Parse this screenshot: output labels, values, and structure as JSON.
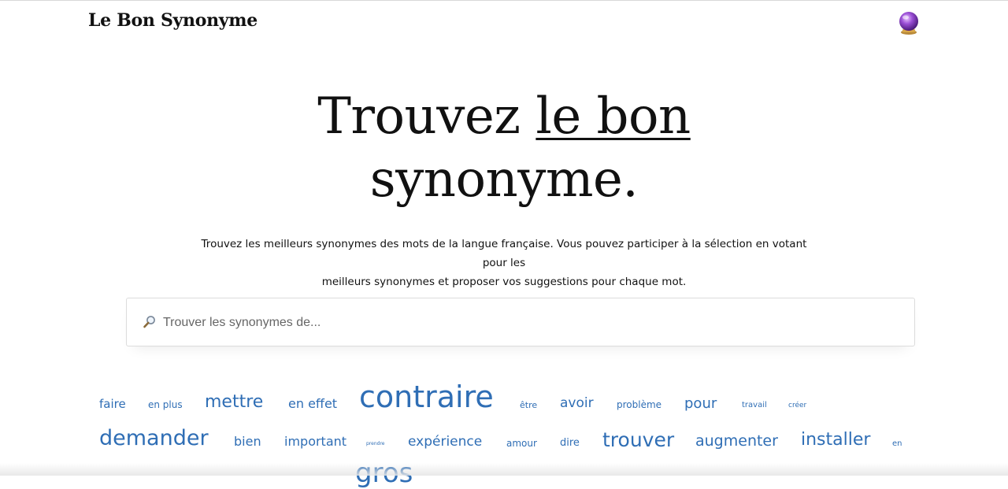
{
  "header": {
    "brand": "Le Bon Synonyme",
    "icon": "crystal-ball-icon"
  },
  "hero": {
    "part1": "Trouvez ",
    "highlight": "le bon",
    "part2": "synonyme."
  },
  "intro": {
    "line1": "Trouvez les meilleurs synonymes des mots de la langue française. Vous pouvez participer à la sélection en votant pour les",
    "line2": "meilleurs synonymes et proposer vos suggestions pour chaque mot."
  },
  "search": {
    "placeholder": "Trouver les synonymes de...",
    "icon": "magnifier-icon"
  },
  "cloud": {
    "words": [
      "faire",
      "en plus",
      "mettre",
      "en effet",
      "contraire",
      "être",
      "avoir",
      "problème",
      "pour",
      "travail",
      "créer",
      "demander",
      "bien",
      "important",
      "prendre",
      "expérience",
      "amour",
      "dire",
      "trouver",
      "augmenter",
      "installer",
      "en",
      "gros"
    ]
  },
  "colors": {
    "link": "#2f6eb5",
    "text": "#111111",
    "border": "#dcdcdc"
  }
}
